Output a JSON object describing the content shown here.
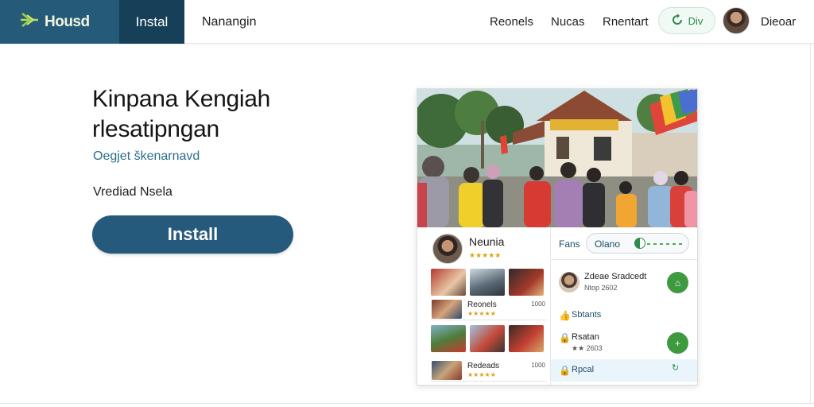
{
  "header": {
    "brand": "Housd",
    "tabs": [
      {
        "label": "Instal",
        "active": true
      },
      {
        "label": "Nanangin",
        "active": false
      }
    ],
    "nav": [
      "Reonels",
      "Nucas",
      "Rnentart"
    ],
    "pill_label": "Div",
    "user": "Dieoar"
  },
  "hero": {
    "title": "Kinpana Kengiah rlesatipngan",
    "subtitle": "Oegjet škenarnavd",
    "label": "Vrediad Nsela",
    "install_label": "Install"
  },
  "card": {
    "profile": {
      "name": "Neunia",
      "stars": "★★★★★"
    },
    "left_list": [
      {
        "title": "Reonels",
        "meta": "★★★★★",
        "num": "1000"
      },
      {
        "title": "Redeads",
        "meta": "★★★★★",
        "num": "1000"
      }
    ],
    "right": {
      "fans_label": "Fans",
      "search_text": "Olano",
      "item1_title": "Zdeae Sradcedt",
      "item1_meta": "Ntop 2602",
      "item2_title": "Sbtants",
      "item3_title": "Rsatan",
      "item3_meta": "★★ 2603",
      "item4_title": "Rpcal"
    }
  },
  "colors": {
    "brand_bg": "#255a79",
    "active_tab": "#163f58",
    "accent_green": "#3e9a3e",
    "install_button": "#265a7c"
  },
  "icons": [
    "brand-leaf-icon",
    "refresh-icon",
    "thumbs-up-icon",
    "lock-icon",
    "house-icon",
    "plus-icon"
  ]
}
